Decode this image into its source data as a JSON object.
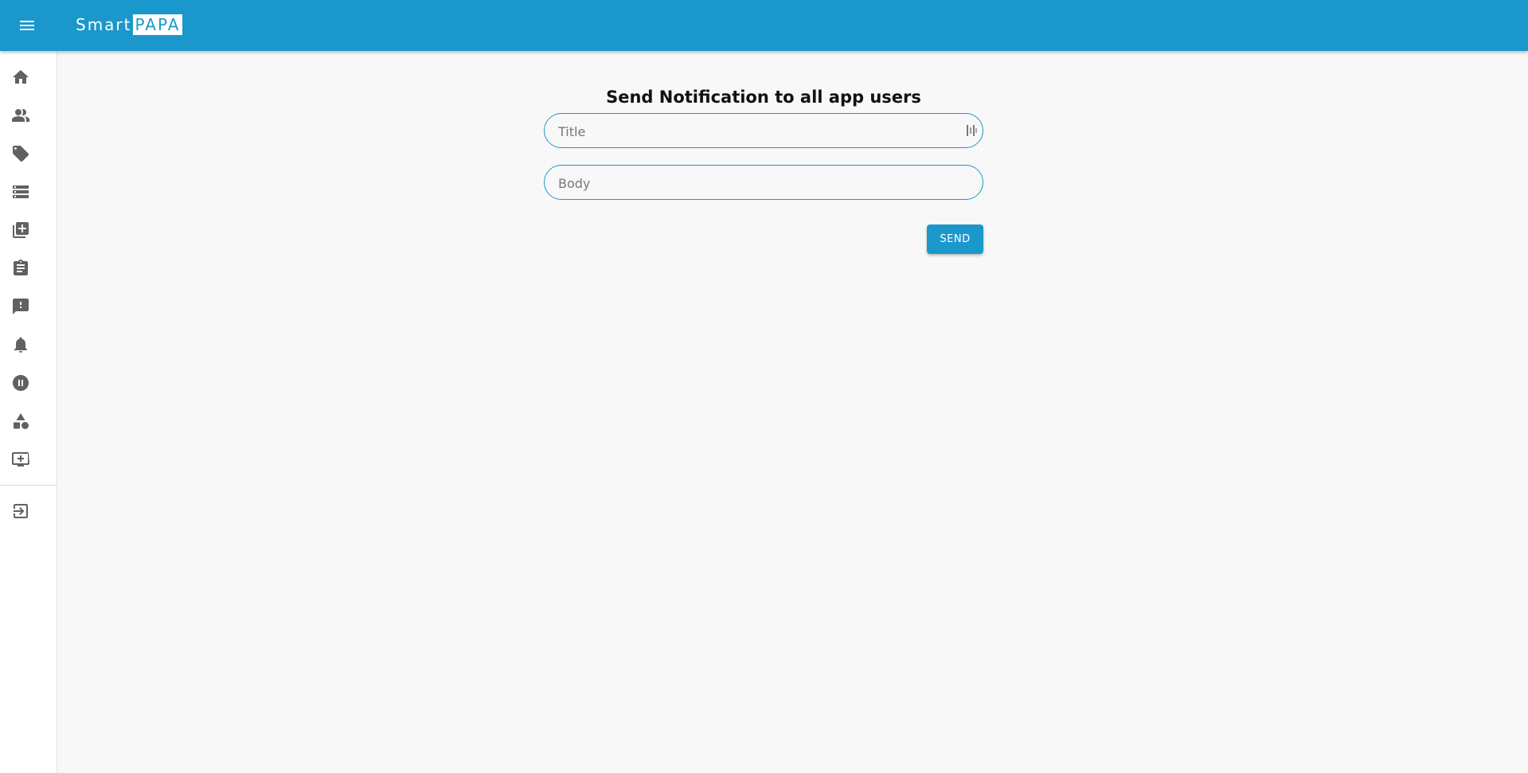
{
  "brand": {
    "part1": "Smart",
    "part2": "PAPA"
  },
  "colors": {
    "primary": "#1b98cb",
    "background": "#f8f8f8",
    "icon": "#616161"
  },
  "header": {
    "menu_icon": "menu-icon"
  },
  "sidebar": {
    "items": [
      {
        "icon": "home-icon"
      },
      {
        "icon": "people-icon"
      },
      {
        "icon": "tag-icon"
      },
      {
        "icon": "list-icon"
      },
      {
        "icon": "library-add-icon"
      },
      {
        "icon": "clipboard-icon"
      },
      {
        "icon": "feedback-icon"
      },
      {
        "icon": "bell-icon"
      },
      {
        "icon": "sound-circle-icon"
      },
      {
        "icon": "shapes-icon"
      },
      {
        "icon": "add-to-queue-icon"
      }
    ],
    "logout_icon": "logout-icon"
  },
  "main": {
    "title": "Send Notification to all app users",
    "title_field": {
      "placeholder": "Title",
      "value": ""
    },
    "body_field": {
      "placeholder": "Body",
      "value": ""
    },
    "send_label": "SEND"
  }
}
